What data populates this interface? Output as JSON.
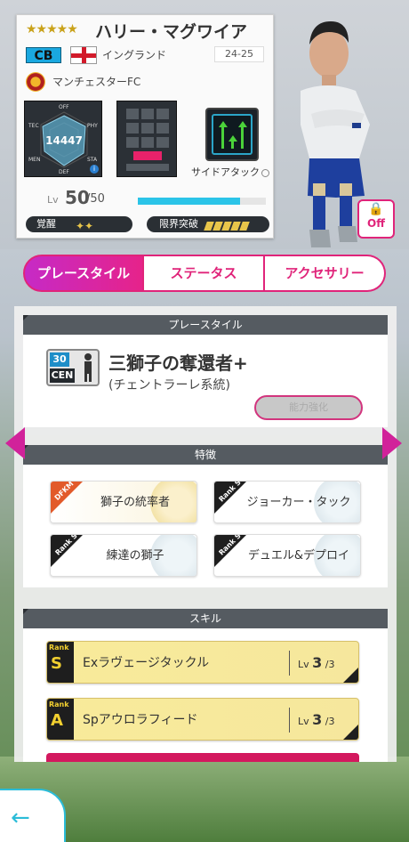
{
  "player": {
    "stars": "★★★★★",
    "name": "ハリー・マグワイア",
    "position": "CB",
    "country": "イングランド",
    "season": "24-25",
    "club": "マンチェスターFC",
    "overall": "14447",
    "radar_labels": [
      "OFF",
      "PHY",
      "STA",
      "DEF",
      "MEN",
      "TEC"
    ],
    "side_attack_label": "サイドアタック",
    "lv_label": "Lv",
    "lv_value": "50",
    "lv_max": "/50",
    "lv_fill_fraction": 0.8,
    "awakening_label": "覚醒",
    "awakening_icons": "✦✦",
    "limit_break_label": "限界突破",
    "lock_label": "Off"
  },
  "tabs": [
    {
      "label": "プレースタイル"
    },
    {
      "label": "ステータス"
    },
    {
      "label": "アクセサリー"
    }
  ],
  "playstyle_section": {
    "header": "プレースタイル",
    "icon_num": "30",
    "icon_pos": "CEN",
    "name": "三獅子の奪還者+",
    "sub": "(チェントラーレ系統)",
    "button": "能力強化"
  },
  "traits_section": {
    "header": "特徴",
    "items": [
      {
        "rank_label": "DFKM",
        "label": "獅子の統率者"
      },
      {
        "rank_label": "Rank S",
        "label": "ジョーカー・タックル超"
      },
      {
        "rank_label": "Rank S",
        "label": "練達の獅子"
      },
      {
        "rank_label": "Rank S",
        "label": "デュエル&デプロイ"
      }
    ]
  },
  "skills_section": {
    "header": "スキル",
    "items": [
      {
        "rank_word": "Rank",
        "rank": "S",
        "name": "Exラヴェージタックル",
        "lv_prefix": "Lv",
        "lv": "3",
        "lv_max": "/3"
      },
      {
        "rank_word": "Rank",
        "rank": "A",
        "name": "Spアウロラフィード",
        "lv_prefix": "Lv",
        "lv": "3",
        "lv_max": "/3"
      }
    ]
  },
  "colors": {
    "accent": "#e0247a",
    "tab_active_start": "#c62ac6",
    "cyan": "#2bc4e8"
  },
  "icons": {
    "back": "arrow-left-icon",
    "lock": "lock-icon",
    "nav_left": "triangle-left-icon",
    "nav_right": "triangle-right-icon"
  }
}
